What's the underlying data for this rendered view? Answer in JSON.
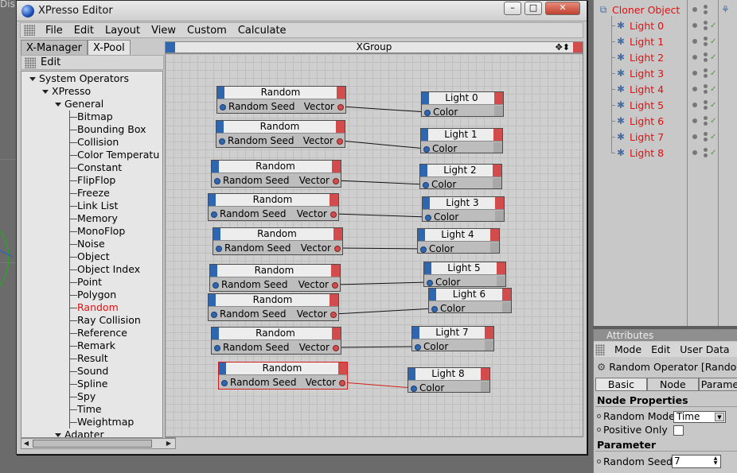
{
  "background": {
    "viewport_label": "Disp"
  },
  "window": {
    "title": "XPresso Editor",
    "minimize": "–",
    "maximize": "□",
    "close": "✕"
  },
  "menu": [
    "File",
    "Edit",
    "Layout",
    "View",
    "Custom",
    "Calculate"
  ],
  "left_panel": {
    "tabs": [
      "X-Manager",
      "X-Pool"
    ],
    "edit_label": "Edit",
    "tree": {
      "system": "System Operators",
      "xpresso": "XPresso",
      "general": "General",
      "items": [
        "Bitmap",
        "Bounding Box",
        "Collision",
        "Color Temperatu",
        "Constant",
        "FlipFlop",
        "Freeze",
        "Link List",
        "Memory",
        "MonoFlop",
        "Noise",
        "Object",
        "Object Index",
        "Point",
        "Polygon",
        "Random",
        "Ray Collision",
        "Reference",
        "Remark",
        "Result",
        "Sound",
        "Spline",
        "Spy",
        "Time",
        "Weightmap"
      ],
      "selected": "Random",
      "adapter": "Adapter"
    }
  },
  "graph": {
    "title": "XGroup",
    "header_icons": "✥⬍",
    "random_title": "Random",
    "random_in": "Random Seed",
    "random_out": "Vector",
    "light_in": "Color",
    "lights": [
      "Light 0",
      "Light 1",
      "Light 2",
      "Light 3",
      "Light 4",
      "Light 5",
      "Light 6",
      "Light 7",
      "Light 8"
    ]
  },
  "object_manager": {
    "cloner": "Cloner Object",
    "children": [
      "Light 0",
      "Light 1",
      "Light 2",
      "Light 3",
      "Light 4",
      "Light 5",
      "Light 6",
      "Light 7",
      "Light 8"
    ],
    "label_color": "#e01010"
  },
  "attributes": {
    "header": "Attributes",
    "menu": [
      "Mode",
      "Edit",
      "User Data"
    ],
    "object_title": "Random Operator [Random]",
    "tabs": [
      "Basic",
      "Node",
      "Parameter"
    ],
    "section_node": "Node Properties",
    "random_mode_label": "Random Mode",
    "random_mode_value": "Time",
    "positive_only_label": "Positive Only",
    "section_param": "Parameter",
    "random_seed_label": "Random Seed",
    "random_seed_value": "7"
  }
}
